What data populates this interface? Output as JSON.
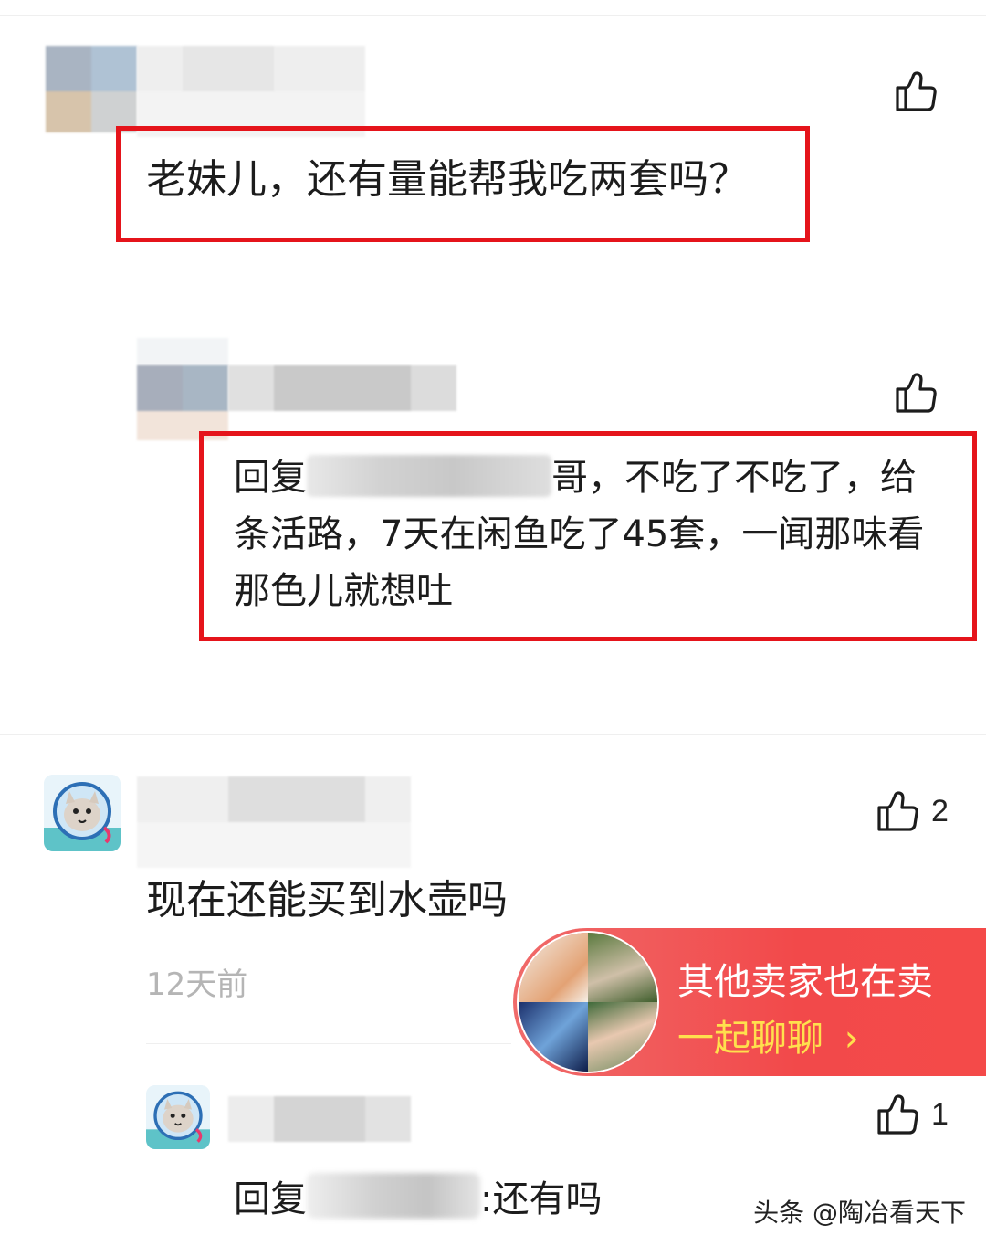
{
  "comments": [
    {
      "text": "老妹儿，还有量能帮我吃两套吗？",
      "likes": "",
      "reply": {
        "prefix": "回复",
        "suffix": "哥，不吃了不吃了，给",
        "line2": "条活路，7天在闲鱼吃了45套，一闻那味看",
        "line3": "那色儿就想吐",
        "likes": ""
      }
    },
    {
      "text": "现在还能买到水壶吗",
      "time": "12天前",
      "likes": "2",
      "reply": {
        "prefix": "回复",
        "suffix": ":还有吗",
        "likes": "1"
      }
    }
  ],
  "banner": {
    "title": "其他卖家也在卖",
    "subtitle": "一起聊聊",
    "chevron": "›"
  },
  "watermark": "头条 @陶冶看天下",
  "colors": {
    "highlight_box": "#e5141b",
    "banner_red": "#f2494a",
    "banner_sub": "#ffe04d"
  }
}
